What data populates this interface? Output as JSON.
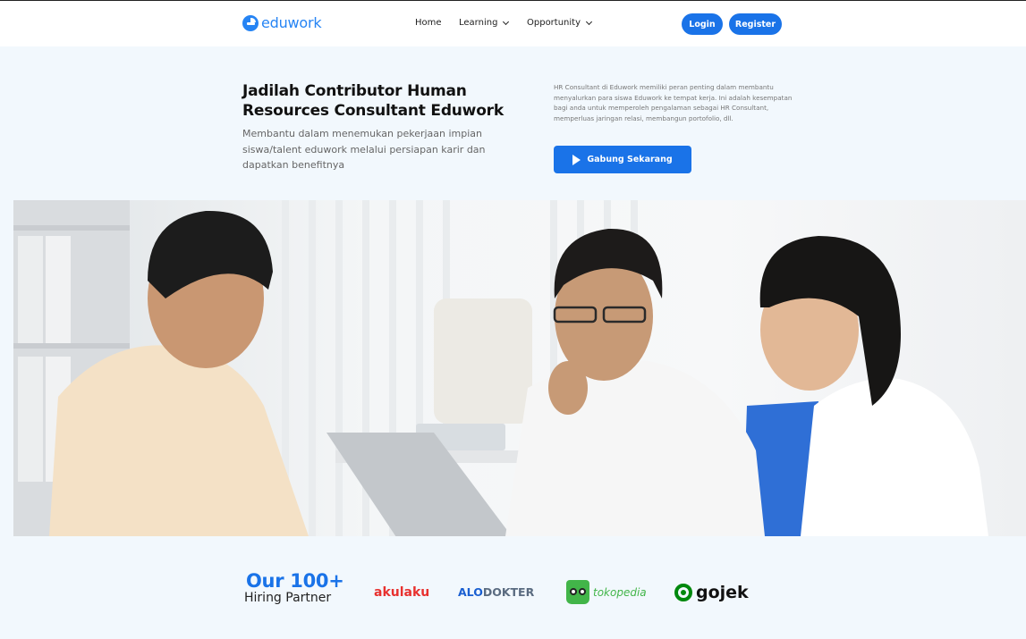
{
  "header": {
    "logo_text": "eduwork",
    "nav": {
      "home": "Home",
      "learning": "Learning",
      "opportunity": "Opportunity"
    },
    "login": "Login",
    "register": "Register"
  },
  "hero": {
    "title": "Jadilah Contributor Human Resources Consultant Eduwork",
    "subtitle": "Membantu dalam menemukan pekerjaan impian siswa/talent eduwork melalui persiapan karir dan dapatkan benefitnya",
    "description": "HR Consultant di Eduwork memiliki peran penting dalam membantu menyalurkan para siswa Eduwork ke tempat kerja. Ini adalah kesempatan bagi anda untuk memperoleh pengalaman sebagai HR Consultant, memperluas jaringan relasi, membangun portofolio, dll.",
    "cta": "Gabung Sekarang"
  },
  "partners": {
    "count_text": "Our 100+",
    "label": "Hiring Partner",
    "brands": {
      "akulaku": "akulaku",
      "alodokter_a": "ALO",
      "alodokter_b": "DOKTER",
      "tokopedia": "tokopedia",
      "gojek": "gojek"
    }
  },
  "colors": {
    "primary": "#1a73e8",
    "background": "#f2f8fd"
  }
}
